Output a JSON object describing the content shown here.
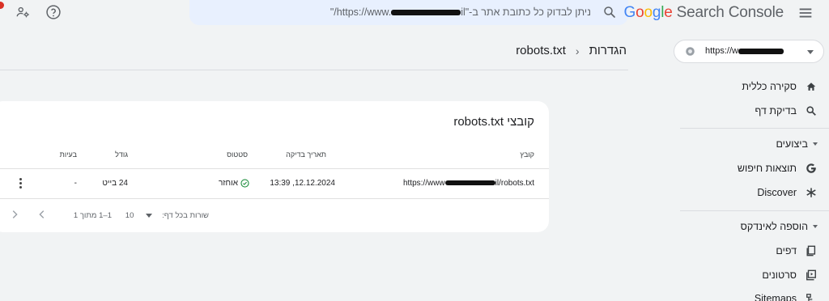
{
  "topbar": {
    "logo_letters": [
      "G",
      "o",
      "o",
      "g",
      "l",
      "e"
    ],
    "logo_product": "Search Console",
    "search_placeholder_prefix": "ניתן לבדוק כל כתובת אתר ב-\"",
    "search_placeholder_mid": "https://www.",
    "search_placeholder_suffix": "il/\"",
    "icons": [
      "menu-icon",
      "search-icon",
      "help-icon",
      "account-settings-icon"
    ]
  },
  "sidebar": {
    "property_url": "https://w",
    "items": [
      {
        "label": "סקירה כללית",
        "icon": "home-icon"
      },
      {
        "label": "בדיקת דף",
        "icon": "search-icon"
      }
    ],
    "section_performance": "ביצועים",
    "performance_items": [
      {
        "label": "תוצאות חיפוש",
        "icon": "google-g-icon"
      },
      {
        "label": "Discover",
        "icon": "asterisk-icon"
      }
    ],
    "section_indexing": "הוספה לאינדקס",
    "indexing_items": [
      {
        "label": "דפים",
        "icon": "pages-icon"
      },
      {
        "label": "סרטונים",
        "icon": "videos-icon"
      },
      {
        "label": "Sitemaps",
        "icon": "sitemap-icon"
      }
    ]
  },
  "header": {
    "crumb_settings": "הגדרות",
    "crumb_sep": "›",
    "crumb_current": "robots.txt"
  },
  "card": {
    "title": "קובצי robots.txt",
    "columns": {
      "file": "קובץ",
      "checked": "תאריך בדיקה",
      "status": "סטטוס",
      "size": "גודל",
      "issues": "בעיות"
    },
    "row": {
      "file_prefix": "https://www",
      "file_suffix": "il/robots.txt",
      "checked": "12.12.2024, 13:39",
      "status": "אוחזר",
      "size": "24 בייט",
      "issues": "-"
    },
    "pager": {
      "rows_label": "שורות בכל דף:",
      "rows_value": "10",
      "range": "1–1 מתוך 1"
    }
  },
  "colors": {
    "accent": "#1a73e8",
    "ok_green": "#1e8e3e",
    "bg": "#f1f3f4",
    "search_bg": "#e8f0fe"
  }
}
